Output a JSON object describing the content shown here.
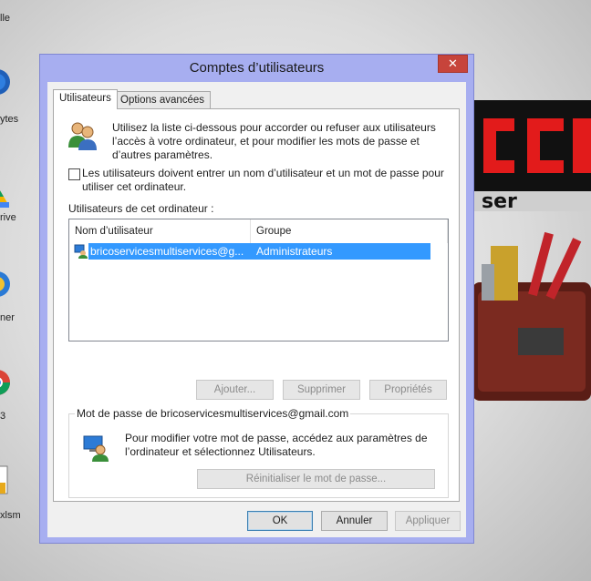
{
  "desktop": {
    "labels": [
      "lle",
      "ytes",
      "rive",
      "ner",
      "3",
      "xlsm"
    ]
  },
  "window": {
    "title": "Comptes d’utilisateurs",
    "close_label": "✕"
  },
  "tabs": [
    {
      "label": "Utilisateurs",
      "active": true
    },
    {
      "label": "Options avancées",
      "active": false
    }
  ],
  "intro_text": [
    "Utilisez la liste ci-dessous pour accorder ou refuser aux utilisateurs",
    "l’accès à votre ordinateur, et pour modifier les mots de passe et",
    "d’autres paramètres."
  ],
  "require_password": {
    "checked": false,
    "line1": "Les utilisateurs doivent entrer un nom d’utilisateur et un mot de passe pour",
    "line2": "utiliser cet ordinateur."
  },
  "users_label": "Utilisateurs de cet ordinateur :",
  "table": {
    "columns": [
      "Nom d’utilisateur",
      "Groupe"
    ],
    "rows": [
      {
        "name": "bricoservicesmultiservices@g...",
        "group": "Administrateurs",
        "selected": true
      }
    ]
  },
  "user_buttons": {
    "add": "Ajouter...",
    "remove": "Supprimer",
    "properties": "Propriétés"
  },
  "password_group": {
    "title": "Mot de passe de bricoservicesmultiservices@gmail.com",
    "text_line1": "Pour modifier votre mot de passe, accédez aux paramètres de",
    "text_line2": "l’ordinateur et sélectionnez Utilisateurs.",
    "reset_button": "Réinitialiser le mot de passe..."
  },
  "dialog_buttons": {
    "ok": "OK",
    "cancel": "Annuler",
    "apply": "Appliquer"
  },
  "colors": {
    "frame": "#a7aef0",
    "close": "#c7443b",
    "selection": "#3399ff"
  }
}
